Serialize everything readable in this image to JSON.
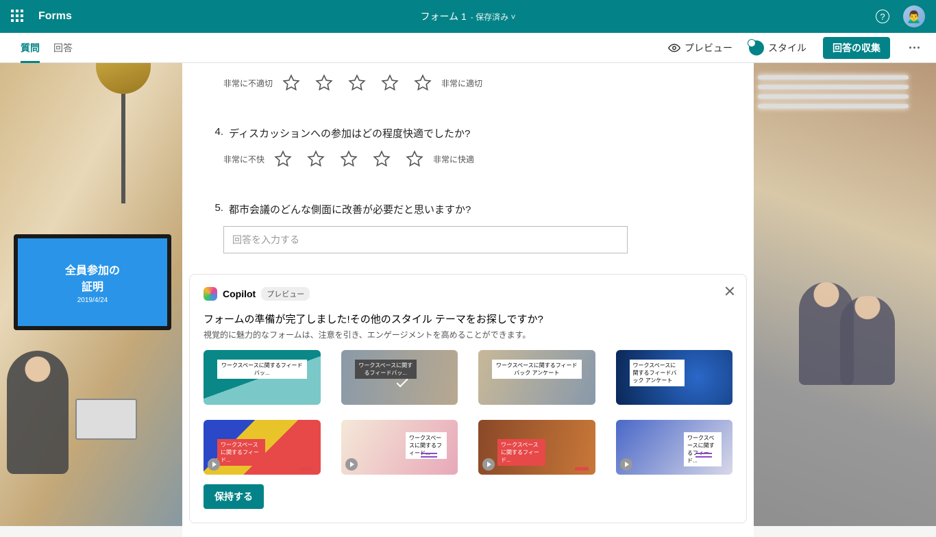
{
  "header": {
    "app_name": "Forms",
    "form_title": "フォーム 1",
    "saved_label": "- 保存済み ˅"
  },
  "toolbar": {
    "tab_questions": "質問",
    "tab_responses": "回答",
    "preview": "プレビュー",
    "style": "スタイル",
    "collect": "回答の収集"
  },
  "bg_screen": {
    "title1": "全員参加の",
    "title2": "証明",
    "date": "2019/4/24"
  },
  "questions": {
    "q3": {
      "label_low": "非常に不適切",
      "label_high": "非常に適切"
    },
    "q4": {
      "num": "4.",
      "text": "ディスカッションへの参加はどの程度快適でしたか?",
      "label_low": "非常に不快",
      "label_high": "非常に快適"
    },
    "q5": {
      "num": "5.",
      "text": "都市会議のどんな側面に改善が必要だと思いますか?",
      "placeholder": "回答を入力する"
    }
  },
  "copilot": {
    "name": "Copilot",
    "preview_badge": "プレビュー",
    "title": "フォームの準備が完了しました!その他のスタイル テーマをお探しですか?",
    "subtitle": "視覚的に魅力的なフォームは、注意を引き、エンゲージメントを高めることができます。",
    "theme_labels": {
      "t1": "ワークスペースに関するフィードバッ...",
      "t2": "ワークスペースに関するフィードバッ...",
      "t3": "ワークスペースに関するフィードバック アンケート",
      "t4": "ワークスペースに関するフィードバック アンケート",
      "t5": "ワークスペースに関するフィード...",
      "t6": "ワークスペースに関するフィード...",
      "t7": "ワークスペースに関するフィード...",
      "t8": "ワークスペースに関するフィード..."
    },
    "keep": "保持する"
  }
}
